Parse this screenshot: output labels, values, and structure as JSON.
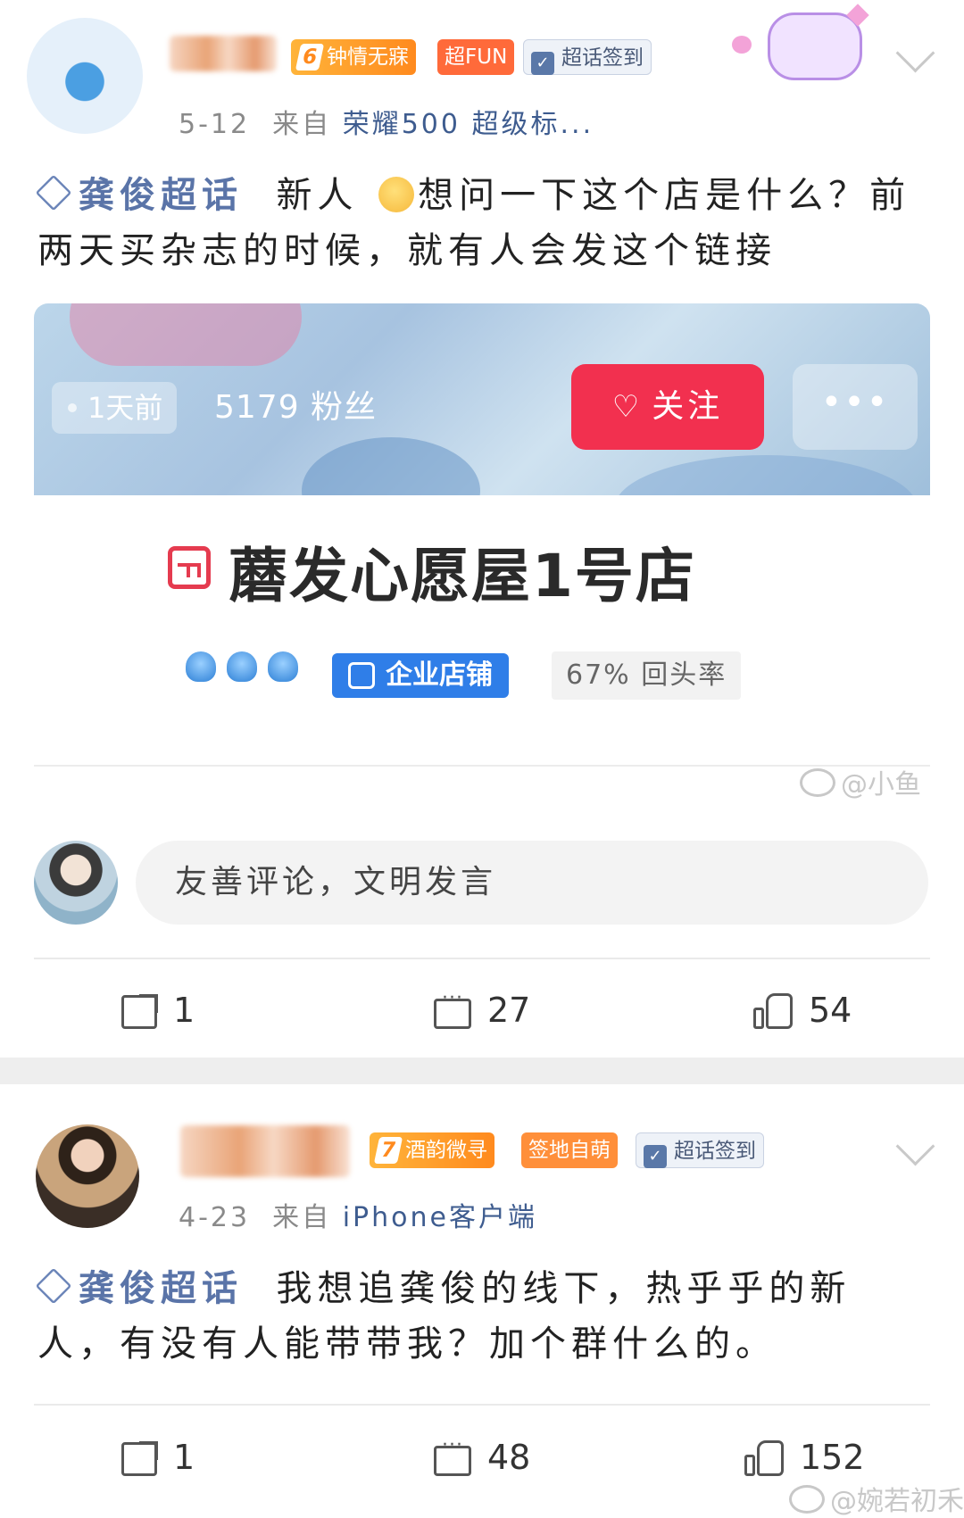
{
  "post1": {
    "badges": {
      "level_num": "6",
      "level_label": "钟情无寐",
      "fun": "超FUN",
      "sign": "超话签到"
    },
    "meta": {
      "date": "5-12",
      "from_prefix": "来自",
      "source": "荣耀500 超级标..."
    },
    "topic": "龚俊超话",
    "text_part1": "新人",
    "text_part2": "想问一下这个店是什么？前两天买杂志的时候，就有人会发这个链接",
    "card": {
      "time": "1天前",
      "fans": "5179 粉丝",
      "follow": "关注",
      "more": "•••",
      "shop_name": "蘑发心愿屋1号店",
      "enterprise_badge": "企业店铺",
      "return_rate": "67% 回头率",
      "watermark": "@小鱼"
    },
    "comment_placeholder": "友善评论，文明发言",
    "actions": {
      "share": "1",
      "comments": "27",
      "likes": "54"
    }
  },
  "post2": {
    "badges": {
      "level_num": "7",
      "level_label": "酒韵微寻",
      "tag": "签地自萌",
      "sign": "超话签到"
    },
    "meta": {
      "date": "4-23",
      "from_prefix": "来自",
      "source": "iPhone客户端"
    },
    "topic": "龚俊超话",
    "text": "我想追龚俊的线下，热乎乎的新人，有没有人能带带我？加个群什么的。",
    "actions": {
      "share": "1",
      "comments": "48",
      "likes": "152"
    },
    "watermark": "@婉若初禾"
  },
  "colors": {
    "topic": "#5a74a8",
    "follow_button": "#f2304f",
    "enterprise_badge": "#2f7ee8",
    "level_badge": "#ff8a1e"
  },
  "icons": [
    "avatar",
    "chevron-down-icon",
    "diamond-topic-icon",
    "praying-emoji-icon",
    "heart-plus-icon",
    "shop-icon",
    "crown-icon",
    "enterprise-icon",
    "share-icon",
    "comment-icon",
    "like-icon",
    "weibo-logo-icon"
  ]
}
